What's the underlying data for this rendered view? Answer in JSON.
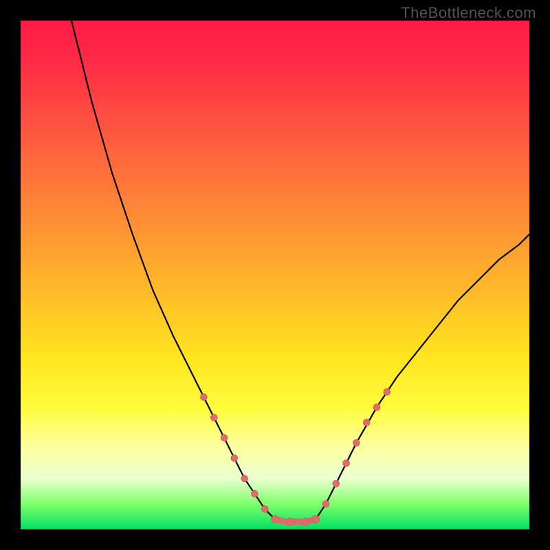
{
  "attribution": "TheBottleneck.com",
  "colors": {
    "frame": "#000000",
    "gradient_top": "#ff1a47",
    "gradient_bottom": "#00e060",
    "curve": "#000000",
    "bead": "#e06b6b"
  },
  "chart_data": {
    "type": "line",
    "title": "",
    "xlabel": "",
    "ylabel": "",
    "xlim": [
      0,
      100
    ],
    "ylim": [
      0,
      100
    ],
    "grid": false,
    "legend": false,
    "annotations": [],
    "series": [
      {
        "name": "left-branch",
        "x": [
          10,
          14,
          18,
          22,
          26,
          30,
          34,
          36,
          38,
          40,
          42,
          44,
          46,
          48,
          50
        ],
        "y": [
          100,
          84,
          70,
          58,
          47,
          38,
          30,
          26,
          22,
          18,
          14,
          10,
          7,
          4,
          2
        ]
      },
      {
        "name": "valley-floor",
        "x": [
          50,
          52,
          54,
          56,
          58
        ],
        "y": [
          2,
          1.5,
          1.5,
          1.5,
          2
        ]
      },
      {
        "name": "right-branch",
        "x": [
          58,
          60,
          62,
          64,
          66,
          70,
          74,
          78,
          82,
          86,
          90,
          94,
          98,
          100
        ],
        "y": [
          2,
          5,
          9,
          13,
          17,
          24,
          30,
          35,
          40,
          45,
          49,
          53,
          56,
          58
        ]
      }
    ],
    "markers": [
      {
        "branch": "left",
        "x": 36,
        "y": 26
      },
      {
        "branch": "left",
        "x": 38,
        "y": 22
      },
      {
        "branch": "left",
        "x": 40,
        "y": 18
      },
      {
        "branch": "left",
        "x": 42,
        "y": 14
      },
      {
        "branch": "left",
        "x": 44,
        "y": 10
      },
      {
        "branch": "left",
        "x": 46,
        "y": 7
      },
      {
        "branch": "left",
        "x": 48,
        "y": 4
      },
      {
        "branch": "floor",
        "x": 50,
        "y": 2
      },
      {
        "branch": "floor",
        "x": 53,
        "y": 1.5
      },
      {
        "branch": "floor",
        "x": 56,
        "y": 1.5
      },
      {
        "branch": "floor",
        "x": 58,
        "y": 2
      },
      {
        "branch": "right",
        "x": 60,
        "y": 5
      },
      {
        "branch": "right",
        "x": 62,
        "y": 9
      },
      {
        "branch": "right",
        "x": 64,
        "y": 13
      },
      {
        "branch": "right",
        "x": 66,
        "y": 17
      },
      {
        "branch": "right",
        "x": 68,
        "y": 21
      },
      {
        "branch": "right",
        "x": 70,
        "y": 24
      },
      {
        "branch": "right",
        "x": 72,
        "y": 27
      }
    ]
  }
}
